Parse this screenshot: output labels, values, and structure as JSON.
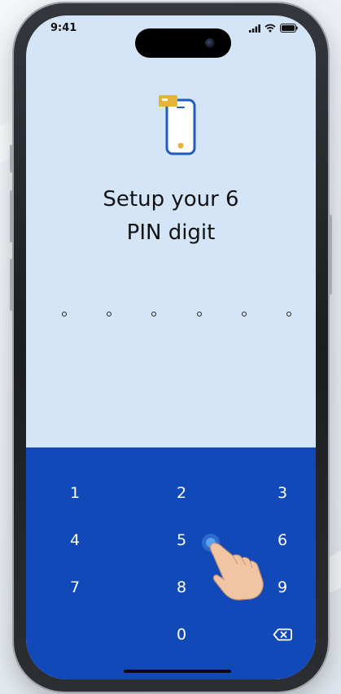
{
  "status_bar": {
    "time": "9:41"
  },
  "onboarding": {
    "title_line1": "Setup your 6",
    "title_line2": "PIN digit",
    "pin_length": 6,
    "pin_filled": 0
  },
  "keypad": {
    "keys": [
      "1",
      "2",
      "3",
      "4",
      "5",
      "6",
      "7",
      "8",
      "9",
      "0"
    ],
    "delete_icon": "backspace-icon"
  },
  "colors": {
    "screen_background": "#d5e5f8",
    "keypad_background": "#1249b8",
    "accent_yellow": "#e6b33a",
    "illustration_stroke": "#1f5cc0"
  }
}
